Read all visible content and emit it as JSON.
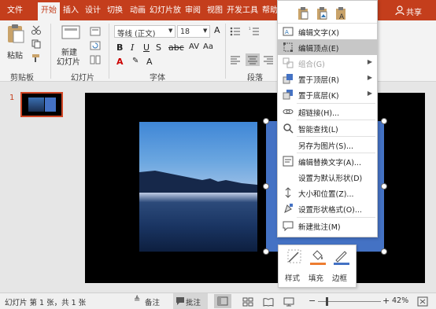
{
  "tabs": [
    "文件",
    "开始",
    "插入",
    "设计",
    "切换",
    "动画",
    "幻灯片放",
    "审阅",
    "视图",
    "开发工具",
    "帮助"
  ],
  "share_label": "共享",
  "ribbon": {
    "paste_label": "粘贴",
    "new_slide_label_1": "新建",
    "new_slide_label_2": "幻灯片",
    "font_name": "等线 (正文)",
    "font_size": "18",
    "groups": {
      "clipboard": "剪贴板",
      "slides": "幻灯片",
      "font": "字体",
      "paragraph": "段落"
    }
  },
  "thumbnail_number": "1",
  "context_menu": {
    "items": [
      {
        "label": "编辑文字(X)",
        "icon": "edit-text-icon",
        "enabled": true,
        "submenu": false
      },
      {
        "label": "编辑顶点(E)",
        "icon": "edit-points-icon",
        "enabled": true,
        "submenu": false,
        "highlighted": true
      },
      {
        "label": "组合(G)",
        "icon": "group-icon",
        "enabled": false,
        "submenu": true
      },
      {
        "label": "置于顶层(R)",
        "icon": "bring-to-front-icon",
        "enabled": true,
        "submenu": true
      },
      {
        "label": "置于底层(K)",
        "icon": "send-to-back-icon",
        "enabled": true,
        "submenu": true
      },
      {
        "label": "超链接(H)...",
        "icon": "hyperlink-icon",
        "enabled": true,
        "submenu": false
      },
      {
        "label": "智能查找(L)",
        "icon": "smart-lookup-icon",
        "enabled": true,
        "submenu": false
      },
      {
        "label": "另存为图片(S)...",
        "icon": "",
        "enabled": true,
        "submenu": false
      },
      {
        "label": "编辑替换文字(A)...",
        "icon": "alt-text-icon",
        "enabled": true,
        "submenu": false
      },
      {
        "label": "设置为默认形状(D)",
        "icon": "",
        "enabled": true,
        "submenu": false
      },
      {
        "label": "大小和位置(Z)...",
        "icon": "size-position-icon",
        "enabled": true,
        "submenu": false
      },
      {
        "label": "设置形状格式(O)...",
        "icon": "format-shape-icon",
        "enabled": true,
        "submenu": false
      },
      {
        "label": "新建批注(M)",
        "icon": "new-comment-icon",
        "enabled": true,
        "submenu": false
      }
    ]
  },
  "mini_toolbar": {
    "style": "样式",
    "fill": "填充",
    "outline": "边框"
  },
  "status": {
    "slide_info": "幻灯片 第 1 张，共 1 张",
    "notes": "备注",
    "comments": "批注",
    "zoom": "42%"
  },
  "colors": {
    "accent": "#c43e1c",
    "shape_fill": "#4472c4",
    "fill_bar": "#ed7d31",
    "outline_bar": "#4472c4"
  }
}
